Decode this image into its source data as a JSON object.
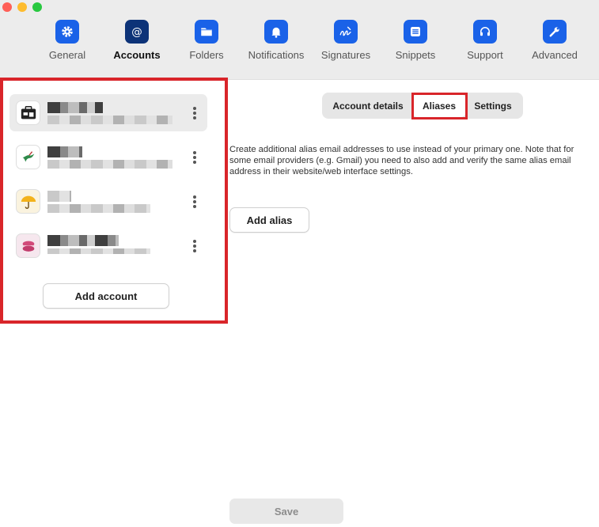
{
  "toolbar": {
    "tabs": [
      {
        "label": "General",
        "icon": "gear-icon"
      },
      {
        "label": "Accounts",
        "icon": "at-icon",
        "active": true
      },
      {
        "label": "Folders",
        "icon": "folder-icon"
      },
      {
        "label": "Notifications",
        "icon": "bell-icon"
      },
      {
        "label": "Signatures",
        "icon": "signature-icon"
      },
      {
        "label": "Snippets",
        "icon": "snippets-icon"
      },
      {
        "label": "Support",
        "icon": "headset-icon"
      },
      {
        "label": "Advanced",
        "icon": "wrench-icon"
      }
    ]
  },
  "accounts": {
    "items": [
      {
        "avatar": "briefcase-icon",
        "selected": true
      },
      {
        "avatar": "hummingbird-icon"
      },
      {
        "avatar": "umbrella-icon"
      },
      {
        "avatar": "macaron-icon"
      }
    ],
    "add_label": "Add account"
  },
  "detail": {
    "tabs": [
      {
        "label": "Account details"
      },
      {
        "label": "Aliases",
        "active": true
      },
      {
        "label": "Settings"
      }
    ],
    "description": "Create additional alias email addresses to use instead of your primary one. Note that for some email providers (e.g. Gmail) you need to also add and verify the same alias email address in their website/web interface settings.",
    "add_alias_label": "Add alias",
    "save_label": "Save"
  },
  "colors": {
    "accent": "#1a62e8",
    "accent_active": "#0d3378",
    "highlight": "#d9252a"
  }
}
